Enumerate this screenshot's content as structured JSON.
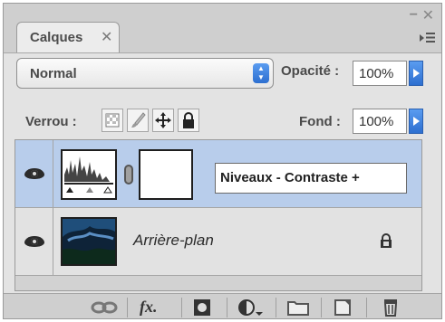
{
  "panel": {
    "tab_label": "Calques",
    "tab_close": "✕",
    "window_minimize": "−",
    "window_close": "✕"
  },
  "blend": {
    "mode": "Normal",
    "opacity_label": "Opacité :",
    "opacity_value": "100%"
  },
  "lock": {
    "label": "Verrou :",
    "fill_label": "Fond :",
    "fill_value": "100%"
  },
  "layers": [
    {
      "name": "Niveaux - Contraste +",
      "selected": true,
      "type": "adjustment"
    },
    {
      "name": "Arrière-plan",
      "selected": false,
      "type": "background"
    }
  ],
  "toolbar": {
    "fx_label": "fx."
  },
  "colors": {
    "accent_blue": "#2d6fd0",
    "selected_row": "#b8cdeb"
  }
}
